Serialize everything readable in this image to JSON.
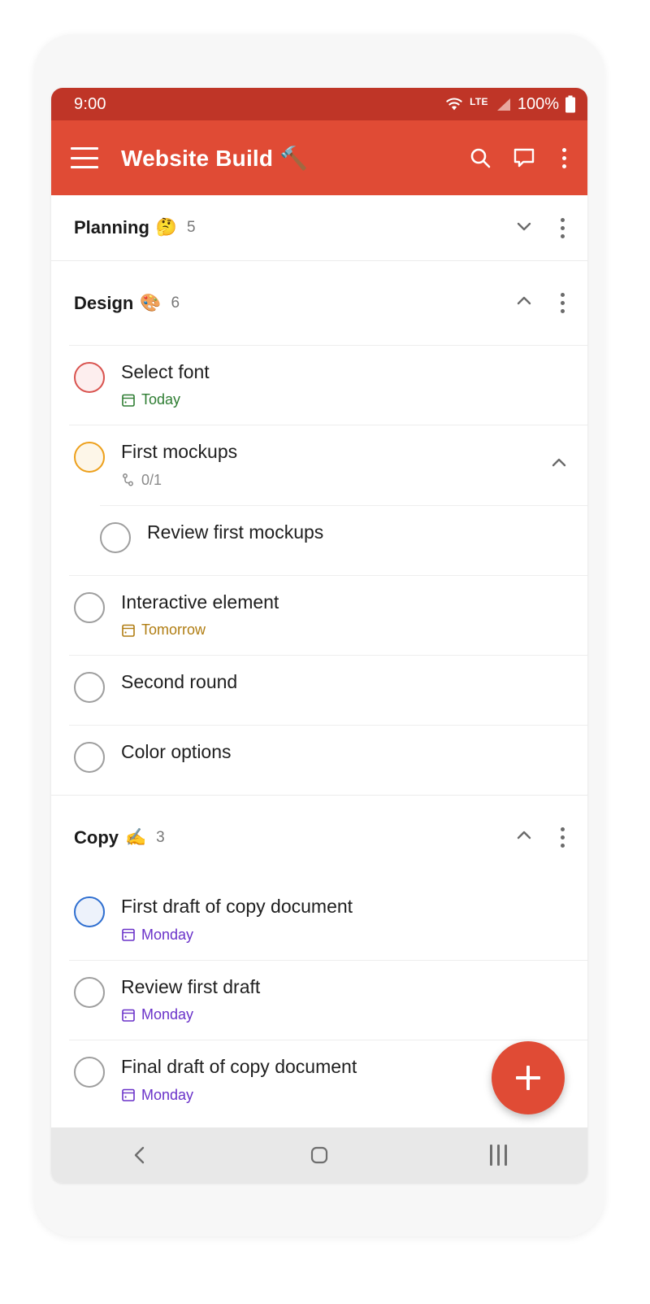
{
  "status_bar": {
    "clock": "9:00",
    "wifi_icon": "wifi-icon",
    "network_label": "LTE",
    "signal_icon": "signal-bars-icon",
    "battery_percent": "100%",
    "battery_icon": "battery-full-icon",
    "background_color": "#bf3527"
  },
  "app_bar": {
    "menu_icon": "hamburger-menu-icon",
    "title": "Website Build 🔨",
    "search_icon": "search-icon",
    "comment_icon": "comment-icon",
    "overflow_icon": "overflow-menu-icon",
    "background_color": "#e04b35"
  },
  "sections": [
    {
      "name": "Planning",
      "emoji": "🤔",
      "count": "5",
      "collapsed": true,
      "chevron": "chevron-down-icon",
      "menu_icon": "section-overflow-icon"
    },
    {
      "name": "Design",
      "emoji": "🎨",
      "count": "6",
      "collapsed": false,
      "chevron": "chevron-up-icon",
      "menu_icon": "section-overflow-icon"
    },
    {
      "name": "Copy",
      "emoji": "✍️",
      "count": "3",
      "collapsed": false,
      "chevron": "chevron-up-icon",
      "menu_icon": "section-overflow-icon"
    }
  ],
  "design_tasks": [
    {
      "title": "Select font",
      "checkbox_state": "red",
      "meta_text": "Today",
      "meta_icon": "calendar-icon",
      "meta_color": "#2e7d32"
    },
    {
      "title": "First mockups",
      "checkbox_state": "amber",
      "meta_text": "0/1",
      "meta_icon": "subtask-icon",
      "meta_color": "#8a8a8a",
      "expand_chevron": "chevron-up-icon"
    },
    {
      "title": "Review first mockups",
      "checkbox_state": "empty",
      "is_subtask": true
    },
    {
      "title": "Interactive element",
      "checkbox_state": "empty",
      "meta_text": "Tomorrow",
      "meta_icon": "calendar-icon",
      "meta_color": "#b07d12"
    },
    {
      "title": "Second round",
      "checkbox_state": "empty"
    },
    {
      "title": "Color options",
      "checkbox_state": "empty"
    }
  ],
  "copy_tasks": [
    {
      "title": "First draft of copy document",
      "checkbox_state": "blue",
      "meta_text": "Monday",
      "meta_icon": "calendar-icon",
      "meta_color": "#6a32c9"
    },
    {
      "title": "Review first draft",
      "checkbox_state": "empty",
      "meta_text": "Monday",
      "meta_icon": "calendar-icon",
      "meta_color": "#6a32c9"
    },
    {
      "title": "Final draft of copy document",
      "checkbox_state": "empty",
      "meta_text": "Monday",
      "meta_icon": "calendar-icon",
      "meta_color": "#6a32c9"
    }
  ],
  "fab": {
    "icon": "plus-icon",
    "color": "#e04b35"
  },
  "nav_bar": {
    "back_icon": "back-chevron-icon",
    "home_icon": "home-square-icon",
    "recents_icon": "recents-bars-icon",
    "background_color": "#e8e8e8"
  }
}
